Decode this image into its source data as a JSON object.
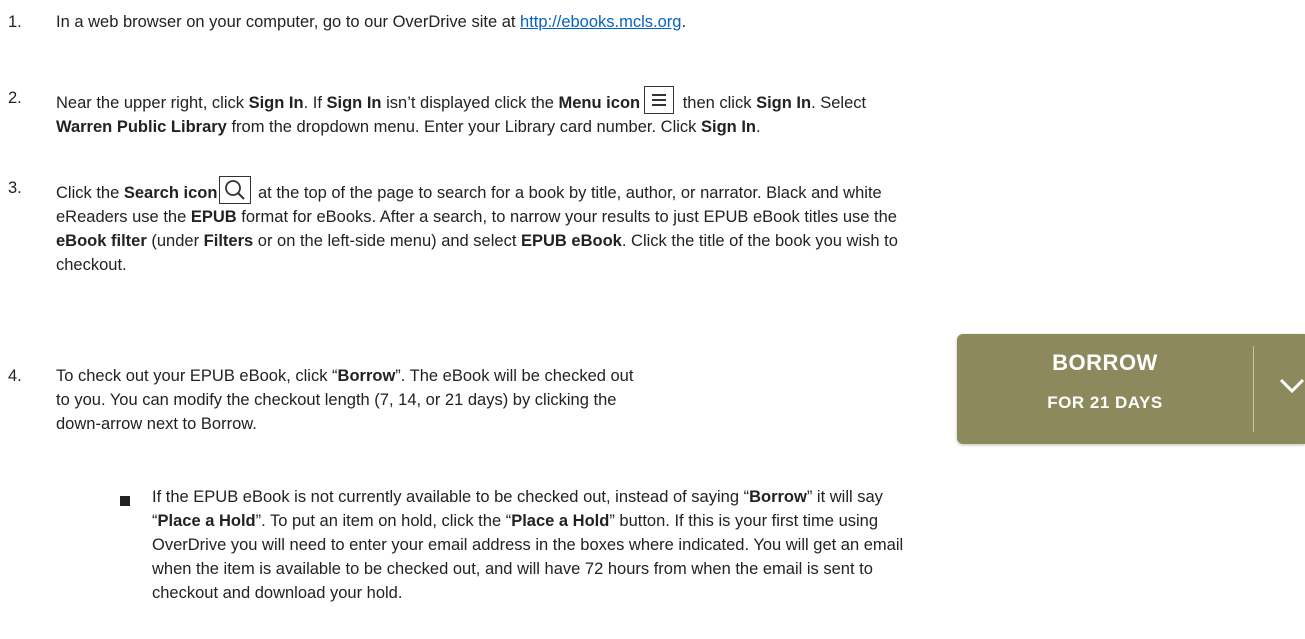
{
  "steps": [
    {
      "num": "1.",
      "l1": "In a web browser on your computer, go to our OverDrive site at ",
      "link": "http://ebooks.mcls.org",
      "l1_end": "."
    },
    {
      "num": "2.",
      "a1": "Near the upper right, click ",
      "b1": "Sign In",
      "a2": ". If ",
      "b2": "Sign In",
      "a3": " isn’t displayed click the ",
      "b3": "Menu icon",
      "a4": " then click ",
      "b4": "Sign In",
      "a5": ". Select",
      "b5": "Warren Public Library",
      "a6": " from the dropdown menu. Enter your Library card number.  Click ",
      "b6": "Sign In",
      "a7": "."
    },
    {
      "num": "3.",
      "a1": "Click the ",
      "b1": "Search icon",
      "a2": " at the top of the page to search for a book by title, author, or narrator. Black and white",
      "a3": "eReaders use the ",
      "b2": "EPUB",
      "a4": " format for eBooks.  After a search, to narrow your results to just EPUB eBook titles use the",
      "b3": "eBook filter",
      "a5": " (under ",
      "b4": "Filters",
      "a6": " or on the left-side menu) and select ",
      "b5": "EPUB eBook",
      "a7": ". Click the title of the book you wish to",
      "a8": "checkout."
    },
    {
      "num": "4.",
      "a1": "To check out your EPUB eBook, click “",
      "b1": "Borrow",
      "a2": "”. The eBook will be checked out",
      "a3": "to you. You can modify the checkout length (7, 14, or 21 days) by clicking the",
      "a4": "down-arrow next to Borrow."
    }
  ],
  "borrow_button": {
    "label": "BORROW",
    "sublabel": "FOR 21 DAYS",
    "color": "#8c8a5c"
  },
  "bullet": {
    "a1": "If the EPUB eBook is not currently available to be checked out, instead of saying “",
    "b1": "Borrow",
    "a2": "” it will say",
    "a3": "“",
    "b2": "Place a Hold",
    "a4": "”. To put an item on hold, click the “",
    "b3": "Place a Hold",
    "a5": "” button. If this is your first time using",
    "a6": "OverDrive you will need to enter your email address in the boxes where indicated. You will get an email",
    "a7": "when the item is available to be checked out, and will have 72 hours from when the email is sent to",
    "a8": "checkout and download your hold."
  }
}
